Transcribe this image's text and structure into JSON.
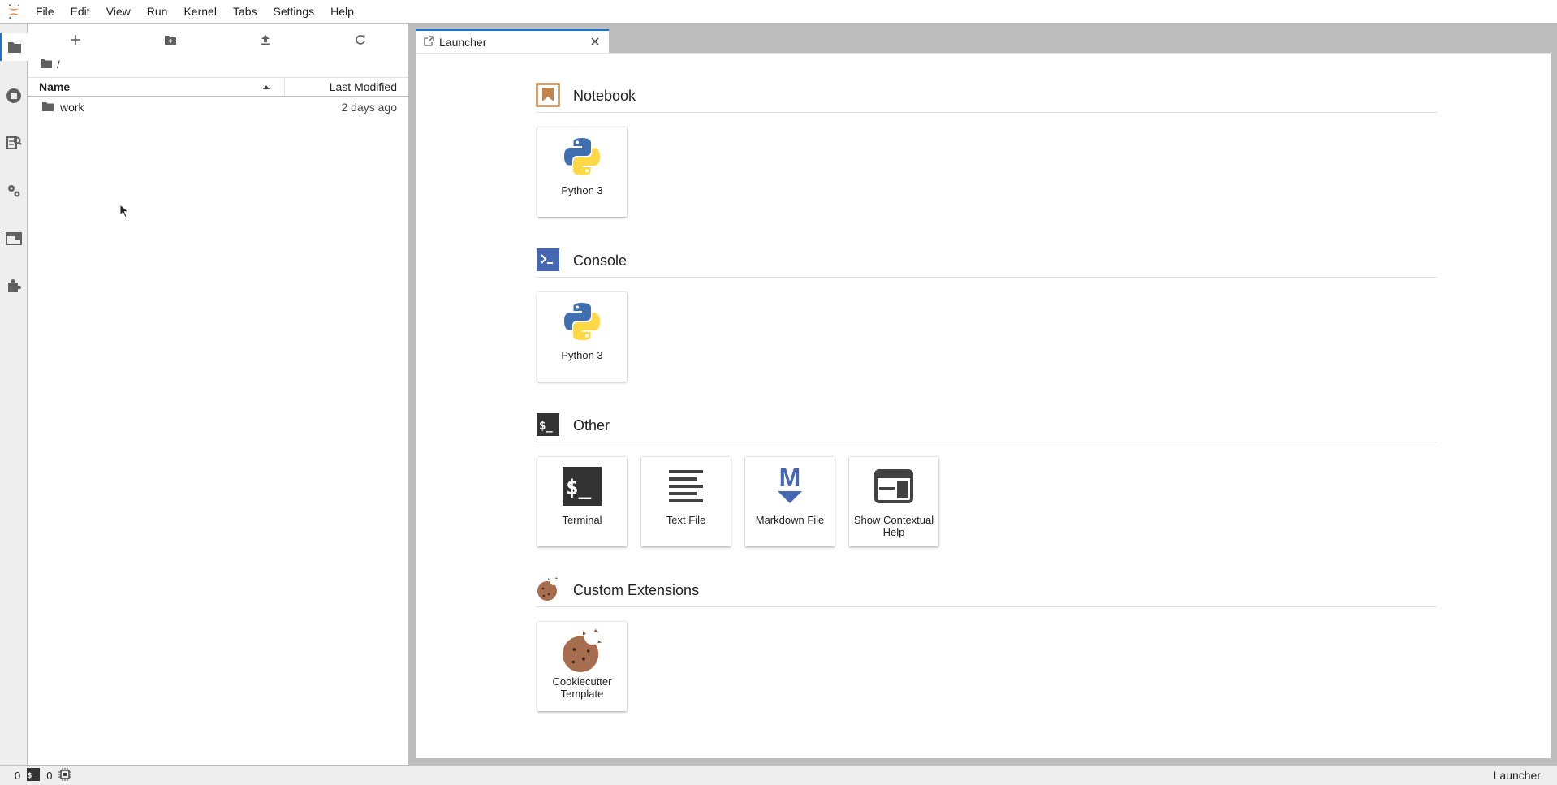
{
  "menu": [
    "File",
    "Edit",
    "View",
    "Run",
    "Kernel",
    "Tabs",
    "Settings",
    "Help"
  ],
  "activity_icons": [
    "folder-icon",
    "running-icon",
    "property-inspector-icon",
    "settings-icon",
    "tabs-icon",
    "extension-icon"
  ],
  "filebrowser": {
    "toolbar": [
      "new-launcher-icon",
      "new-folder-icon",
      "upload-icon",
      "refresh-icon"
    ],
    "breadcrumb": "/",
    "columns": {
      "name": "Name",
      "modified": "Last Modified"
    },
    "files": [
      {
        "name": "work",
        "modified": "2 days ago",
        "type": "folder"
      }
    ]
  },
  "tab": {
    "label": "Launcher"
  },
  "launcher": {
    "sections": [
      {
        "title": "Notebook",
        "cards": [
          {
            "label": "Python 3",
            "icon": "python-icon"
          }
        ]
      },
      {
        "title": "Console",
        "cards": [
          {
            "label": "Python 3",
            "icon": "python-icon"
          }
        ]
      },
      {
        "title": "Other",
        "cards": [
          {
            "label": "Terminal",
            "icon": "terminal-icon"
          },
          {
            "label": "Text File",
            "icon": "text-file-icon"
          },
          {
            "label": "Markdown File",
            "icon": "markdown-icon"
          },
          {
            "label": "Show Contextual Help",
            "icon": "contextual-help-icon"
          }
        ]
      },
      {
        "title": "Custom Extensions",
        "cards": [
          {
            "label": "Cookiecutter Template",
            "icon": "cookie-icon"
          }
        ]
      }
    ]
  },
  "status": {
    "kernels": "0",
    "terminals": "0",
    "right": "Launcher"
  },
  "colors": {
    "accent": "#1976d2",
    "notebook": "#c1844d",
    "console": "#4668b2",
    "terminal": "#333333",
    "python_blue": "#3f6fb1",
    "python_yellow": "#ffd845",
    "markdown": "#4668b2"
  }
}
